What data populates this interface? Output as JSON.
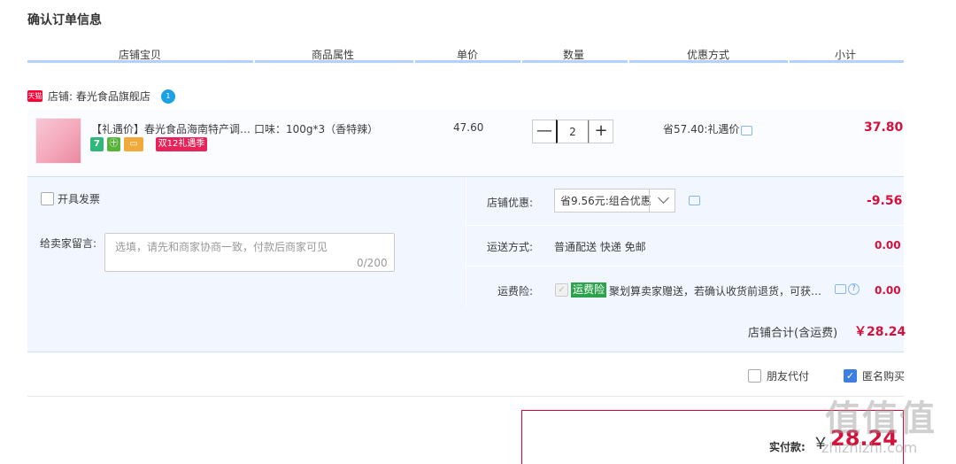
{
  "page_title": "确认订单信息",
  "columns": [
    "店铺宝贝",
    "商品属性",
    "单价",
    "数量",
    "优惠方式",
    "小计"
  ],
  "shop": {
    "badge": "天猫",
    "name": "店铺: 春光食品旗舰店",
    "chat_badge": "1"
  },
  "item": {
    "title": "【礼遇价】春光食品海南特产调味…",
    "tags": [
      "7",
      "㊉",
      "▭",
      "双12礼遇季"
    ],
    "attr": "口味：100g*3（香特辣）",
    "price": "47.60",
    "qty": "2",
    "qty_minus": "—",
    "qty_plus": "+",
    "promo": "省57.40:礼遇价",
    "subtotal": "37.80"
  },
  "invoice_label": "开具发票",
  "memo": {
    "label": "给卖家留言:",
    "placeholder": "选填，请先和商家协商一致，付款后商家可见",
    "count": "0/200"
  },
  "discount": {
    "label": "店铺优惠:",
    "selected": "省9.56元:组合优惠",
    "amount": "-9.56"
  },
  "shipping": {
    "label": "运送方式:",
    "value": "普通配送 快递 免邮",
    "amount": "0.00"
  },
  "insurance": {
    "label": "运费险:",
    "badge": "运费险",
    "text": "聚划算卖家赠送，若确认收货前退货，可获得赔付",
    "help": "?",
    "amount": "0.00"
  },
  "shop_total": {
    "label": "店铺合计(含运费)",
    "value": "￥28.24"
  },
  "options": {
    "friend_pay": "朋友代付",
    "anonymous": "匿名购买",
    "check": "✓"
  },
  "payment": {
    "label": "实付款:",
    "yen": "￥",
    "amount": "28.24"
  },
  "watermark": {
    "logo": "值值值",
    "url": "zhizhizhi.com"
  },
  "colors": {
    "accent_red": "#d5103a",
    "header_line": "#b2d1ff",
    "panel_bg": "#f2f7ff",
    "tmall_red": "#ff0036"
  }
}
